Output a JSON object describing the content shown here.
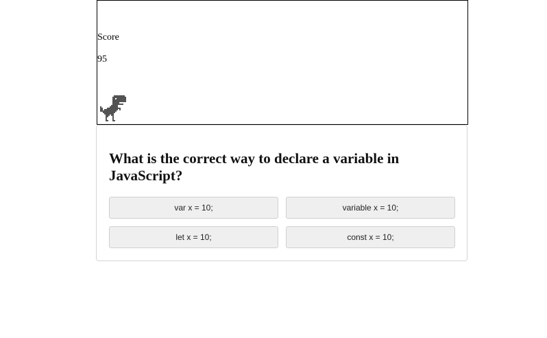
{
  "game": {
    "score_label": "Score",
    "score_value": "95",
    "character": "t-rex-dinosaur-sprite"
  },
  "quiz": {
    "question": "What is the correct way to declare a variable in JavaScript?",
    "answers": [
      "var x = 10;",
      "variable x = 10;",
      "let x = 10;",
      "const x = 10;"
    ]
  },
  "colors": {
    "dino": "#535353",
    "button_bg": "#efefef",
    "button_border": "#cfcfcf",
    "panel_border": "#d4d4d4"
  }
}
